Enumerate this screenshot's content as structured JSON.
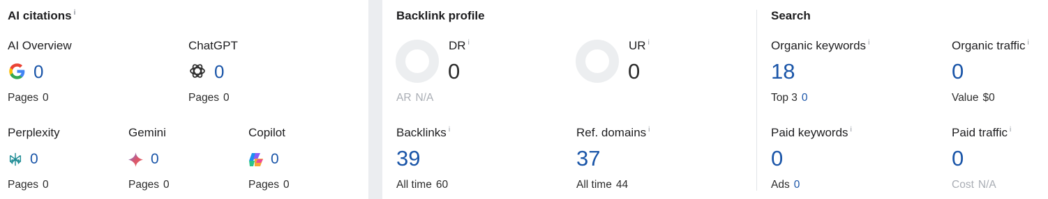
{
  "ai_citations": {
    "title": "AI citations",
    "info": "i",
    "items": [
      {
        "name": "AI Overview",
        "value": "0",
        "pages_label": "Pages",
        "pages": "0",
        "icon": "google-icon"
      },
      {
        "name": "ChatGPT",
        "value": "0",
        "pages_label": "Pages",
        "pages": "0",
        "icon": "chatgpt-icon"
      },
      {
        "name": "Perplexity",
        "value": "0",
        "pages_label": "Pages",
        "pages": "0",
        "icon": "perplexity-icon"
      },
      {
        "name": "Gemini",
        "value": "0",
        "pages_label": "Pages",
        "pages": "0",
        "icon": "gemini-icon"
      },
      {
        "name": "Copilot",
        "value": "0",
        "pages_label": "Pages",
        "pages": "0",
        "icon": "copilot-icon"
      }
    ]
  },
  "backlink_profile": {
    "title": "Backlink profile",
    "dr": {
      "label": "DR",
      "info": "i",
      "value": "0",
      "sub_label": "AR",
      "sub_value": "N/A"
    },
    "ur": {
      "label": "UR",
      "info": "i",
      "value": "0"
    },
    "backlinks": {
      "label": "Backlinks",
      "info": "i",
      "value": "39",
      "sub_label": "All time",
      "sub_value": "60"
    },
    "ref_domains": {
      "label": "Ref. domains",
      "info": "i",
      "value": "37",
      "sub_label": "All time",
      "sub_value": "44"
    }
  },
  "search": {
    "title": "Search",
    "organic_keywords": {
      "label": "Organic keywords",
      "info": "i",
      "value": "18",
      "sub_label": "Top 3",
      "sub_value": "0"
    },
    "organic_traffic": {
      "label": "Organic traffic",
      "info": "i",
      "value": "0",
      "sub_label": "Value",
      "sub_value": "$0"
    },
    "paid_keywords": {
      "label": "Paid keywords",
      "info": "i",
      "value": "0",
      "sub_label": "Ads",
      "sub_value": "0"
    },
    "paid_traffic": {
      "label": "Paid traffic",
      "info": "i",
      "value": "0",
      "sub_label": "Cost",
      "sub_value": "N/A"
    }
  },
  "colors": {
    "value_blue": "#1a55a8",
    "muted": "#a9adb4",
    "ring": "#eceef0",
    "background": "#ebedf0"
  }
}
